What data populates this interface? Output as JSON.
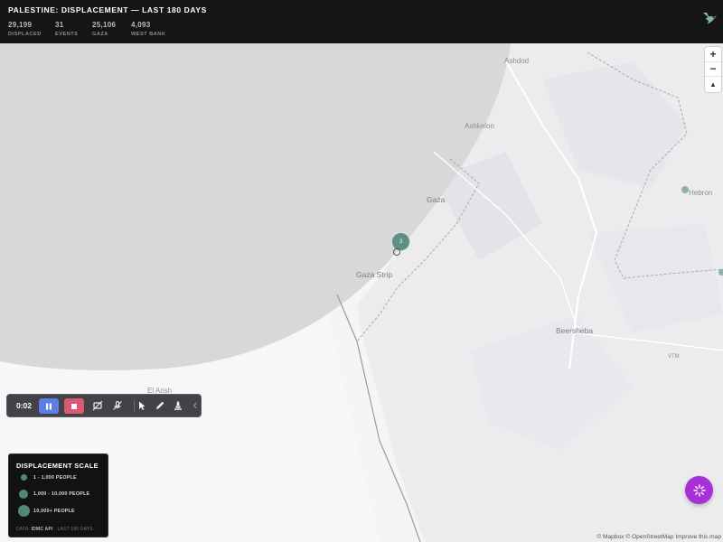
{
  "header": {
    "title": "PALESTINE: DISPLACEMENT — LAST 180 DAYS",
    "stats": [
      {
        "value": "29,199",
        "label": "DISPLACED"
      },
      {
        "value": "31",
        "label": "EVENTS"
      },
      {
        "value": "25,106",
        "label": "GAZA"
      },
      {
        "value": "4,093",
        "label": "WEST BANK"
      }
    ],
    "logo_icon": "hummingbird-icon"
  },
  "map": {
    "places": {
      "ashdod": "Ashdod",
      "ashkelon": "Ashkelon",
      "gaza": "Gaza",
      "gaza_strip": "Gaza Strip",
      "beersheba": "Beersheba",
      "hebron": "Hebron",
      "el_arish": "El Arish",
      "vtm": "VTM"
    },
    "marker": {
      "count": "3"
    },
    "zoom": {
      "in": "+",
      "out": "−",
      "compass": "▲"
    },
    "attribution": {
      "mapbox": "© Mapbox",
      "osm": "© OpenStreetMap",
      "improve": "Improve this map"
    }
  },
  "toolbar": {
    "time": "0:02",
    "icons": [
      "pause-icon",
      "stop-icon",
      "camera-off-icon",
      "mic-off-icon",
      "pointer-icon",
      "pen-icon",
      "highlighter-icon",
      "chevron-left-icon"
    ]
  },
  "legend": {
    "title": "DISPLACEMENT SCALE",
    "items": [
      {
        "label": "1 - 1,000 PEOPLE"
      },
      {
        "label": "1,000 - 10,000 PEOPLE"
      },
      {
        "label": "10,000+ PEOPLE"
      }
    ],
    "source_prefix": "DATA:",
    "source_api": "IDMC API",
    "source_suffix": "· LAST 180 DAYS"
  },
  "colors": {
    "header_bg": "#151515",
    "marker": "#5e8f83",
    "legend_dot": "#4e8a77",
    "pause_button": "#5b7ee8",
    "stop_button": "#dc5a6f",
    "fab": "#a930d6"
  }
}
